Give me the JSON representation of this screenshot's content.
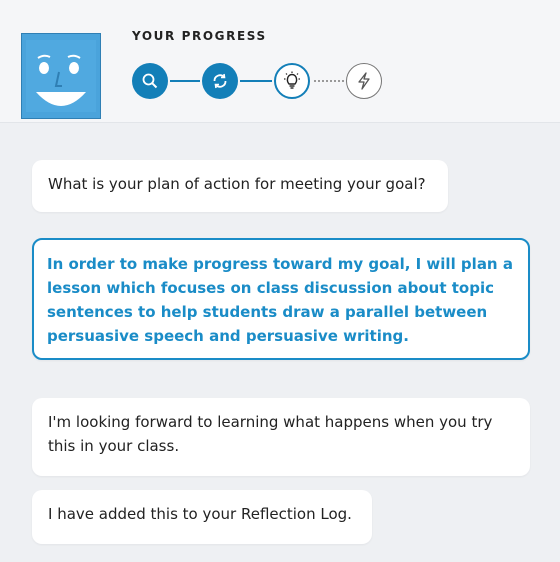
{
  "header": {
    "title": "YOUR PROGRESS",
    "steps": [
      {
        "icon": "search-icon",
        "state": "done"
      },
      {
        "icon": "refresh-icon",
        "state": "done"
      },
      {
        "icon": "lightbulb-icon",
        "state": "current"
      },
      {
        "icon": "lightning-icon",
        "state": "pending"
      }
    ]
  },
  "conversation": {
    "question": "What is your plan of action for meeting your goal?",
    "user_response": "In order to make progress toward my goal, I will plan a lesson which focuses on class discussion about topic sentences to help students draw a parallel between persuasive speech and persuasive writing.",
    "followup": "I'm looking forward to learning what happens when you try this in your class.",
    "confirmation": "I have added this to your Reflection Log."
  },
  "colors": {
    "accent": "#137fb8",
    "avatar": "#4aa3db",
    "background": "#eef0f3"
  }
}
